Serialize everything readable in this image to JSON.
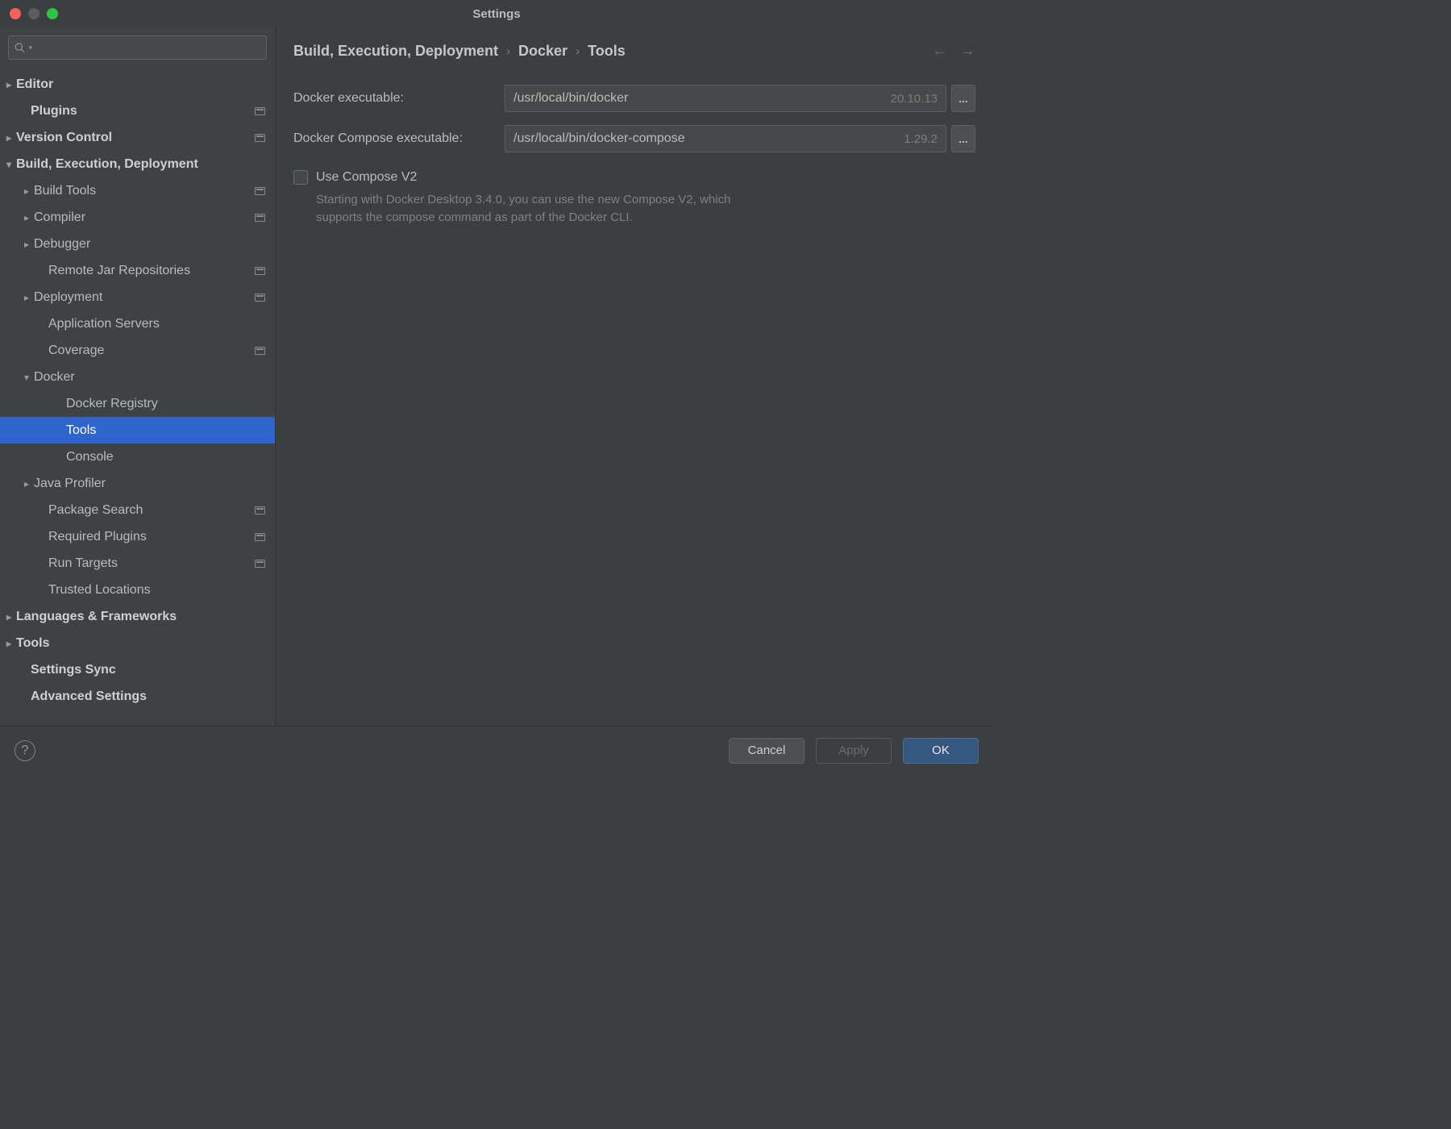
{
  "window": {
    "title": "Settings"
  },
  "search": {
    "placeholder": ""
  },
  "tree": [
    {
      "label": "Editor",
      "indent": 0,
      "bold": true,
      "arrow": "right",
      "badge": false
    },
    {
      "label": "Plugins",
      "indent": 0,
      "bold": true,
      "arrow": "",
      "badge": true
    },
    {
      "label": "Version Control",
      "indent": 0,
      "bold": true,
      "arrow": "right",
      "badge": true
    },
    {
      "label": "Build, Execution, Deployment",
      "indent": 0,
      "bold": true,
      "arrow": "down",
      "badge": false
    },
    {
      "label": "Build Tools",
      "indent": 1,
      "bold": false,
      "arrow": "right",
      "badge": true
    },
    {
      "label": "Compiler",
      "indent": 1,
      "bold": false,
      "arrow": "right",
      "badge": true
    },
    {
      "label": "Debugger",
      "indent": 1,
      "bold": false,
      "arrow": "right",
      "badge": false
    },
    {
      "label": "Remote Jar Repositories",
      "indent": 1,
      "bold": false,
      "arrow": "",
      "badge": true
    },
    {
      "label": "Deployment",
      "indent": 1,
      "bold": false,
      "arrow": "right",
      "badge": true
    },
    {
      "label": "Application Servers",
      "indent": 1,
      "bold": false,
      "arrow": "",
      "badge": false
    },
    {
      "label": "Coverage",
      "indent": 1,
      "bold": false,
      "arrow": "",
      "badge": true
    },
    {
      "label": "Docker",
      "indent": 1,
      "bold": false,
      "arrow": "down",
      "badge": false
    },
    {
      "label": "Docker Registry",
      "indent": 2,
      "bold": false,
      "arrow": "",
      "badge": false
    },
    {
      "label": "Tools",
      "indent": 2,
      "bold": false,
      "arrow": "",
      "badge": false,
      "selected": true
    },
    {
      "label": "Console",
      "indent": 2,
      "bold": false,
      "arrow": "",
      "badge": false
    },
    {
      "label": "Java Profiler",
      "indent": 1,
      "bold": false,
      "arrow": "right",
      "badge": false
    },
    {
      "label": "Package Search",
      "indent": 1,
      "bold": false,
      "arrow": "",
      "badge": true
    },
    {
      "label": "Required Plugins",
      "indent": 1,
      "bold": false,
      "arrow": "",
      "badge": true
    },
    {
      "label": "Run Targets",
      "indent": 1,
      "bold": false,
      "arrow": "",
      "badge": true
    },
    {
      "label": "Trusted Locations",
      "indent": 1,
      "bold": false,
      "arrow": "",
      "badge": false
    },
    {
      "label": "Languages & Frameworks",
      "indent": 0,
      "bold": true,
      "arrow": "right",
      "badge": false
    },
    {
      "label": "Tools",
      "indent": 0,
      "bold": true,
      "arrow": "right",
      "badge": false
    },
    {
      "label": "Settings Sync",
      "indent": 0,
      "bold": true,
      "arrow": "",
      "badge": false
    },
    {
      "label": "Advanced Settings",
      "indent": 0,
      "bold": true,
      "arrow": "",
      "badge": false
    }
  ],
  "breadcrumb": {
    "a": "Build, Execution, Deployment",
    "b": "Docker",
    "c": "Tools",
    "sep": "›"
  },
  "fields": {
    "docker_exe_label": "Docker executable:",
    "docker_exe_value": "/usr/local/bin/docker",
    "docker_exe_version": "20.10.13",
    "compose_exe_label": "Docker Compose executable:",
    "compose_exe_value": "/usr/local/bin/docker-compose",
    "compose_exe_version": "1.29.2",
    "browse": "..."
  },
  "checkbox": {
    "label": "Use Compose V2",
    "help": "Starting with Docker Desktop 3.4.0, you can use the new Compose V2, which supports the compose command as part of the Docker CLI."
  },
  "buttons": {
    "cancel": "Cancel",
    "apply": "Apply",
    "ok": "OK"
  }
}
